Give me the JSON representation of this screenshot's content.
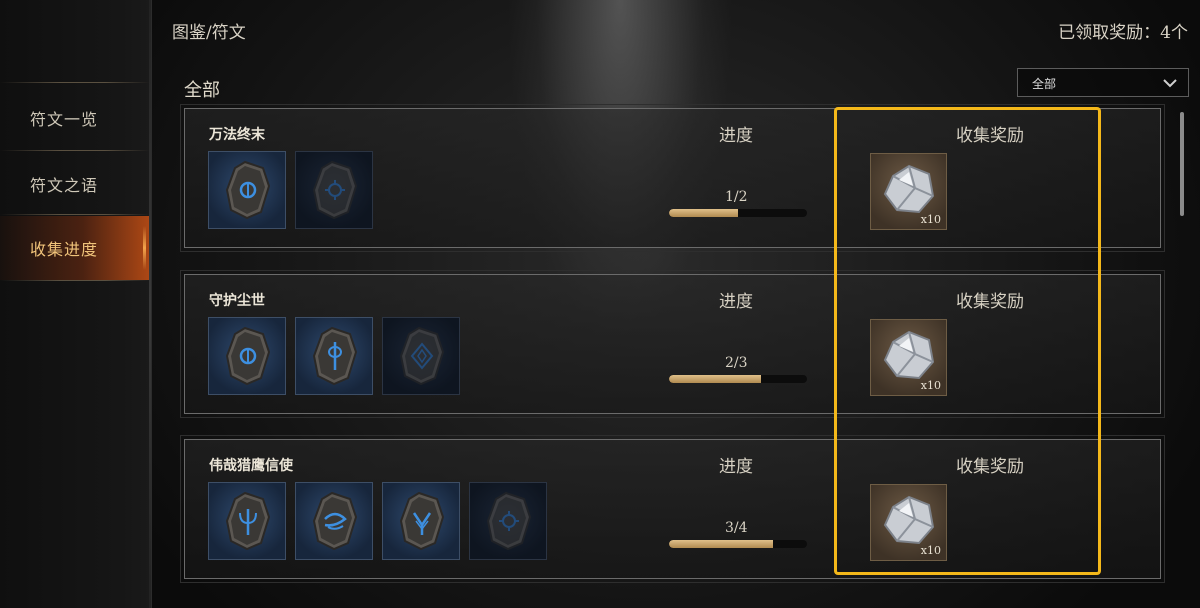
{
  "header": {
    "breadcrumb": "图鉴/符文",
    "claimed_label": "已领取奖励：4个"
  },
  "sidebar": {
    "items": [
      {
        "label": "符文一览",
        "active": false
      },
      {
        "label": "符文之语",
        "active": false
      },
      {
        "label": "收集进度",
        "active": true
      }
    ]
  },
  "section": {
    "title": "全部",
    "filter_value": "全部"
  },
  "columns": {
    "progress": "进度",
    "reward": "收集奖励"
  },
  "rows": [
    {
      "name": "万法终末",
      "progress_text": "1/2",
      "progress_value": 0.5,
      "runes": [
        {
          "icon": "rune-circle-icon",
          "collected": true
        },
        {
          "icon": "rune-sun-icon",
          "collected": false
        }
      ],
      "reward": {
        "icon": "silver-ore-icon",
        "qty": "x10"
      }
    },
    {
      "name": "守护尘世",
      "progress_text": "2/3",
      "progress_value": 0.667,
      "runes": [
        {
          "icon": "rune-circle-icon",
          "collected": true
        },
        {
          "icon": "rune-staff-icon",
          "collected": true
        },
        {
          "icon": "rune-diamond-icon",
          "collected": false
        }
      ],
      "reward": {
        "icon": "silver-ore-icon",
        "qty": "x10"
      }
    },
    {
      "name": "伟哉猎鹰信使",
      "progress_text": "3/4",
      "progress_value": 0.75,
      "runes": [
        {
          "icon": "rune-trident-icon",
          "collected": true
        },
        {
          "icon": "rune-wave-icon",
          "collected": true
        },
        {
          "icon": "rune-fork-icon",
          "collected": true
        },
        {
          "icon": "rune-sun-icon",
          "collected": false
        }
      ],
      "reward": {
        "icon": "silver-ore-icon",
        "qty": "x10"
      }
    }
  ],
  "colors": {
    "accent_active": "#f0c37a",
    "highlight_border": "#f4b81a",
    "progress_fill": "#c9a66b",
    "rune_glyph": "#3d8fe0"
  }
}
